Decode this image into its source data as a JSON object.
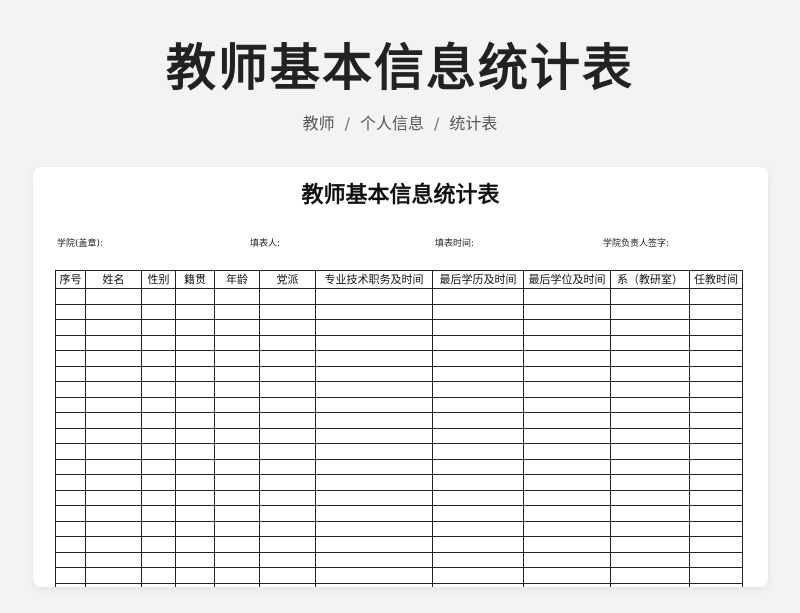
{
  "header": {
    "title": "教师基本信息统计表",
    "breadcrumb": [
      "教师",
      "个人信息",
      "统计表"
    ],
    "separator": "/"
  },
  "document": {
    "title": "教师基本信息统计表",
    "meta": {
      "college": "学院(盖章):",
      "filler": "填表人:",
      "date": "填表时间:",
      "signature": "学院负责人签字:"
    },
    "table": {
      "columns": [
        "序号",
        "姓名",
        "性别",
        "籍贯",
        "年龄",
        "党派",
        "专业技术职务及时间",
        "最后学历及时间",
        "最后学位及时间",
        "系（教研室）",
        "任教时间"
      ],
      "empty_rows": 20
    }
  }
}
